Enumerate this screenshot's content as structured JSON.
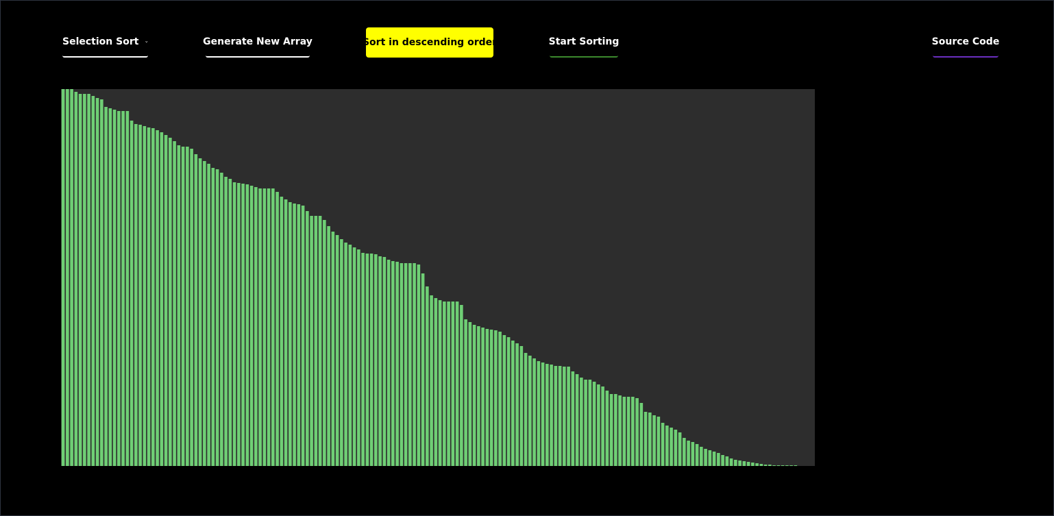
{
  "toolbar": {
    "algorithm_select_label": "Selection Sort",
    "generate_label": "Generate New Array",
    "order_label": "Sort in descending order",
    "start_label": "Start Sorting",
    "source_label": "Source Code"
  },
  "colors": {
    "bar": "#6fcf75",
    "bar_edge": "#000000",
    "chart_bg": "#2d2d2d",
    "order_button_bg": "#ffff00",
    "start_underline": "#3c8a2e",
    "source_underline": "#6a2fc0"
  },
  "icons": {
    "dropdown": "chevron-down-icon"
  },
  "chart_data": {
    "type": "bar",
    "sorted": "descending",
    "values": [
      550,
      550,
      550,
      546,
      543,
      543,
      543,
      540,
      537,
      535,
      524,
      522,
      520,
      518,
      518,
      518,
      504,
      499,
      498,
      496,
      494,
      493,
      490,
      487,
      483,
      479,
      474,
      468,
      466,
      466,
      463,
      455,
      449,
      445,
      441,
      435,
      433,
      428,
      422,
      419,
      414,
      413,
      412,
      411,
      409,
      407,
      405,
      405,
      405,
      405,
      400,
      393,
      389,
      385,
      383,
      382,
      380,
      372,
      365,
      365,
      365,
      359,
      350,
      342,
      337,
      331,
      326,
      323,
      319,
      316,
      311,
      310,
      310,
      309,
      306,
      305,
      301,
      299,
      298,
      296,
      296,
      296,
      296,
      294,
      281,
      262,
      249,
      245,
      242,
      240,
      240,
      240,
      240,
      235,
      214,
      210,
      206,
      204,
      202,
      200,
      199,
      198,
      196,
      191,
      188,
      183,
      179,
      175,
      165,
      161,
      157,
      153,
      151,
      149,
      148,
      146,
      146,
      145,
      145,
      138,
      134,
      129,
      126,
      126,
      123,
      119,
      116,
      110,
      105,
      105,
      103,
      101,
      101,
      101,
      99,
      92,
      79,
      78,
      74,
      72,
      63,
      59,
      56,
      53,
      49,
      41,
      37,
      35,
      32,
      28,
      25,
      23,
      21,
      19,
      16,
      14,
      11,
      9,
      8,
      7,
      6,
      5,
      4,
      3,
      2,
      2,
      1,
      1,
      1,
      1,
      1,
      1
    ]
  }
}
